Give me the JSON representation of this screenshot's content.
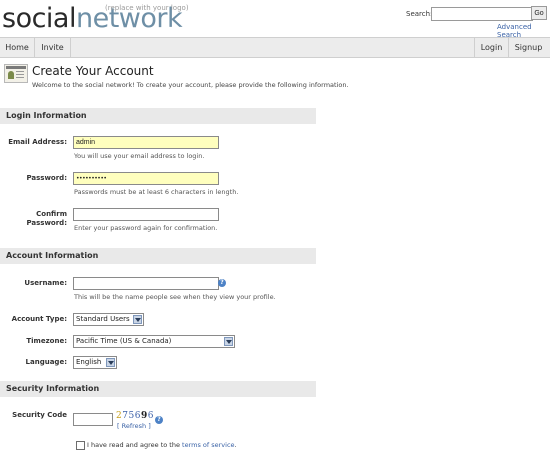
{
  "header": {
    "logo_social": "social",
    "logo_network": "network",
    "logo_note": "(replace with your logo)",
    "search_label": "Search:",
    "search_value": "",
    "go_label": "Go",
    "advanced_search": "Advanced Search"
  },
  "nav": {
    "home": "Home",
    "invite": "Invite",
    "login": "Login",
    "signup": "Signup"
  },
  "page": {
    "title": "Create Your Account",
    "intro": "Welcome to the social network! To create your account, please provide the following information."
  },
  "login_info": {
    "heading": "Login Information",
    "email_label": "Email Address:",
    "email_value": "admin",
    "email_help": "You will use your email address to login.",
    "password_label": "Password:",
    "password_value": "••••••••••",
    "password_help": "Passwords must be at least 6 characters in length.",
    "confirm_label_1": "Confirm",
    "confirm_label_2": "Password:",
    "confirm_value": "",
    "confirm_help": "Enter your password again for confirmation."
  },
  "account_info": {
    "heading": "Account Information",
    "username_label": "Username:",
    "username_value": "",
    "username_help": "This will be the name people see when they view your profile.",
    "account_type_label": "Account Type:",
    "account_type_value": "Standard Users",
    "timezone_label": "Timezone:",
    "timezone_value": "Pacific Time (US & Canada)",
    "language_label": "Language:",
    "language_value": "English"
  },
  "security_info": {
    "heading": "Security Information",
    "code_label": "Security Code",
    "code_value": "",
    "captcha_chars": [
      "2",
      "7",
      "5",
      "6",
      "9",
      "6"
    ],
    "captcha_colors": [
      "#c8a01e",
      "#3a5fa8",
      "#3a5fa8",
      "#3a5fa8",
      "#222222",
      "#3a5fa8"
    ],
    "refresh_open": "[ ",
    "refresh_link": "Refresh",
    "refresh_close": " ]",
    "agree_text": "I have read and agree to the ",
    "terms_link": "terms of service",
    "agree_end": "."
  },
  "icons": {
    "help": "help-icon",
    "title": "account-card-icon"
  },
  "colors": {
    "accent_link": "#3a62a6",
    "filled_input": "#ffffbe",
    "section_bar": "#e9e9e9",
    "logo_network": "#6e8fa6"
  }
}
